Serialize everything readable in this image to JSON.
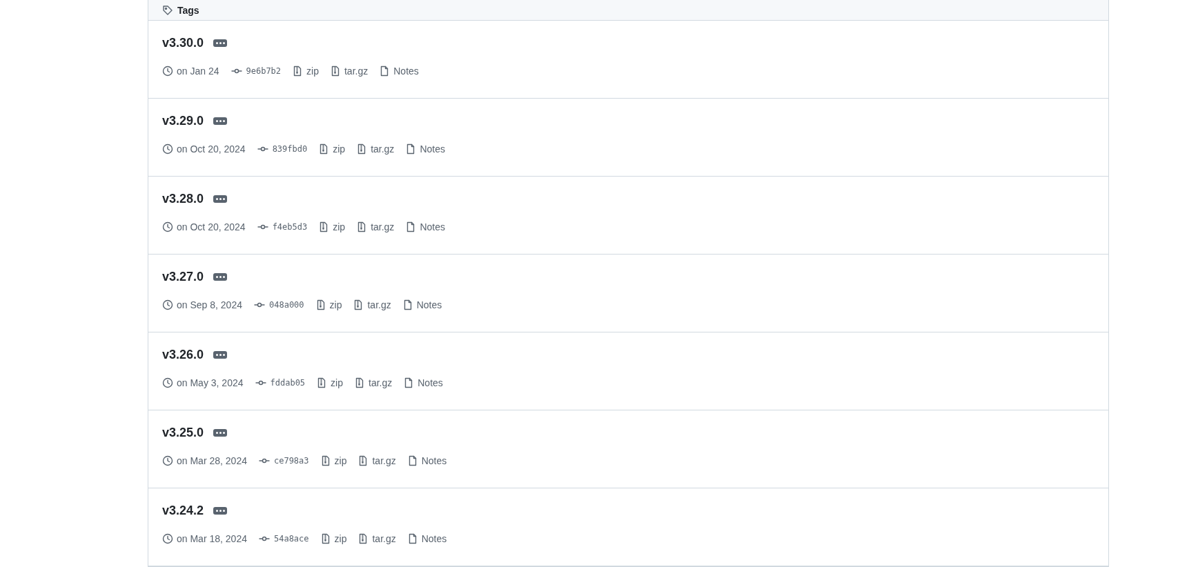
{
  "header": {
    "title": "Tags"
  },
  "tags": [
    {
      "name": "v3.30.0",
      "date": "on Jan 24",
      "commit": "9e6b7b2",
      "zip": "zip",
      "targz": "tar.gz",
      "notes": "Notes"
    },
    {
      "name": "v3.29.0",
      "date": "on Oct 20, 2024",
      "commit": "839fbd0",
      "zip": "zip",
      "targz": "tar.gz",
      "notes": "Notes"
    },
    {
      "name": "v3.28.0",
      "date": "on Oct 20, 2024",
      "commit": "f4eb5d3",
      "zip": "zip",
      "targz": "tar.gz",
      "notes": "Notes"
    },
    {
      "name": "v3.27.0",
      "date": "on Sep 8, 2024",
      "commit": "048a000",
      "zip": "zip",
      "targz": "tar.gz",
      "notes": "Notes"
    },
    {
      "name": "v3.26.0",
      "date": "on May 3, 2024",
      "commit": "fddab05",
      "zip": "zip",
      "targz": "tar.gz",
      "notes": "Notes"
    },
    {
      "name": "v3.25.0",
      "date": "on Mar 28, 2024",
      "commit": "ce798a3",
      "zip": "zip",
      "targz": "tar.gz",
      "notes": "Notes"
    },
    {
      "name": "v3.24.2",
      "date": "on Mar 18, 2024",
      "commit": "54a8ace",
      "zip": "zip",
      "targz": "tar.gz",
      "notes": "Notes"
    }
  ]
}
